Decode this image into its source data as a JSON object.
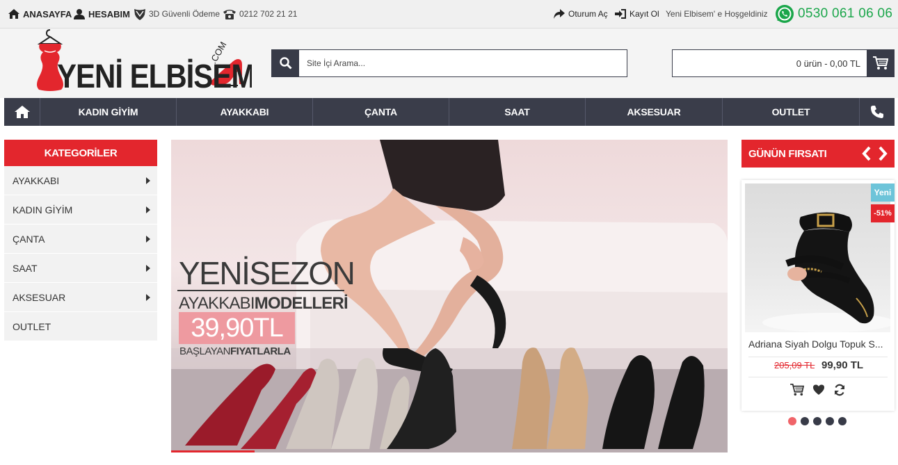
{
  "topbar": {
    "home_label": "ANASAYFA",
    "account_label": "HESABIM",
    "secure_label": "3D Güvenli Ödeme",
    "phone": "0212 702 21 21",
    "login_label": "Oturum Aç",
    "register_label": "Kayıt Ol",
    "welcome": "Yeni Elbisem' e Hoşgeldiniz",
    "whatsapp_phone": "0530 061 06 06"
  },
  "logo": {
    "text": "YENİ ELBİSEM",
    "suffix": ".COM"
  },
  "search": {
    "placeholder": "Site İçi Arama..."
  },
  "cart": {
    "summary": "0 ürün - 0,00 TL"
  },
  "nav": {
    "items": [
      {
        "label": "KADIN GİYİM"
      },
      {
        "label": "AYAKKABI"
      },
      {
        "label": "ÇANTA"
      },
      {
        "label": "SAAT"
      },
      {
        "label": "AKSESUAR"
      },
      {
        "label": "OUTLET"
      }
    ]
  },
  "sidebar": {
    "title": "KATEGORİLER",
    "items": [
      {
        "label": "AYAKKABI",
        "has_sub": true
      },
      {
        "label": "KADIN GİYİM",
        "has_sub": true
      },
      {
        "label": "ÇANTA",
        "has_sub": true
      },
      {
        "label": "SAAT",
        "has_sub": true
      },
      {
        "label": "AKSESUAR",
        "has_sub": true
      },
      {
        "label": "OUTLET",
        "has_sub": false
      }
    ]
  },
  "banner": {
    "line1": "YENİSEZON",
    "line2_a": "AYAKKABI",
    "line2_b": "MODELLERİ",
    "price": "39,90TL",
    "line3_a": "BAŞLAYAN",
    "line3_b": "FIYATLARLA"
  },
  "deal": {
    "title": "GÜNÜN FIRSATI",
    "badge_new": "Yeni",
    "badge_discount": "-51%",
    "product_name": "Adriana Siyah Dolgu Topuk S...",
    "old_price": "205,09 TL",
    "new_price": "99,90 TL",
    "dots": 5,
    "active_dot": 0
  },
  "colors": {
    "accent_red": "#e3262d",
    "dark_nav": "#3a3d4a",
    "whatsapp_green": "#1aa64a",
    "badge_blue": "#6dc4d9",
    "price_pink": "#ee9aa0"
  }
}
